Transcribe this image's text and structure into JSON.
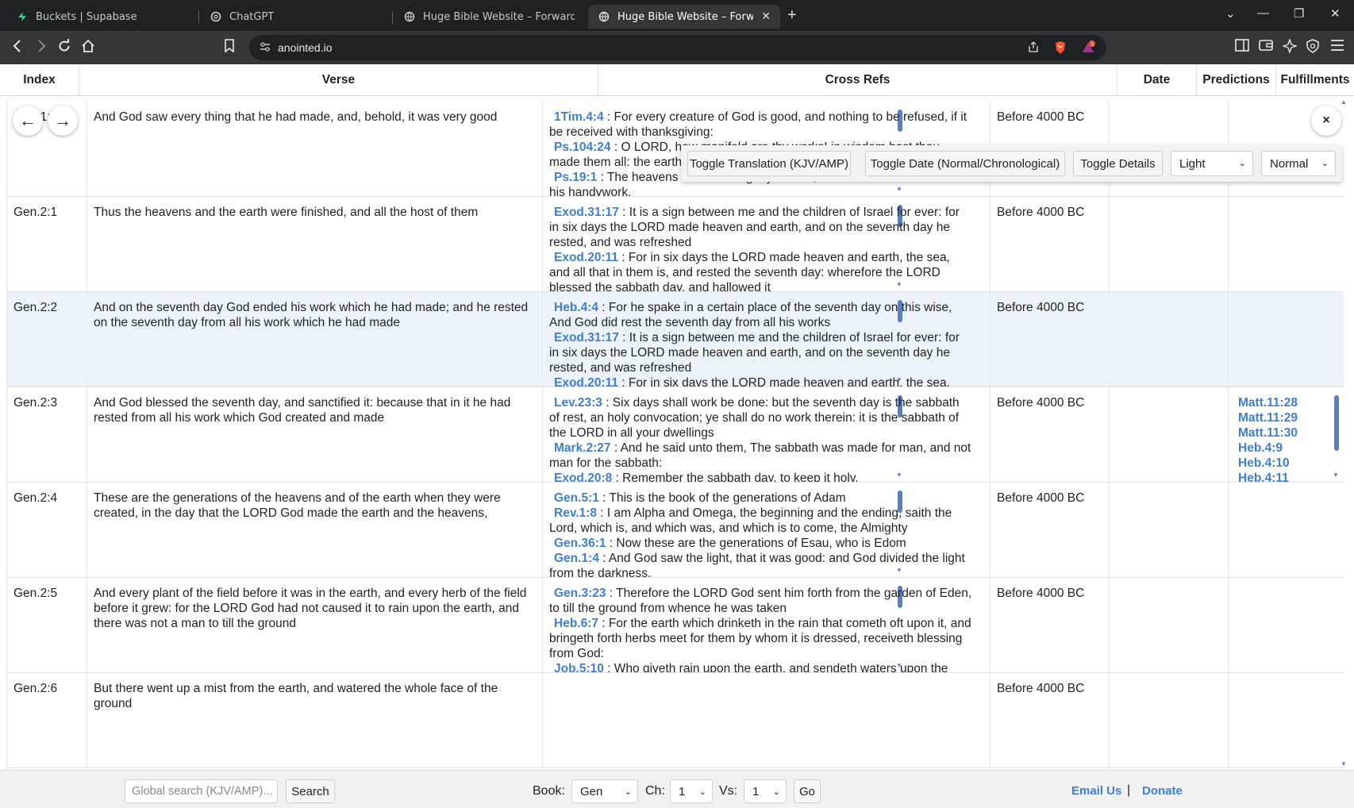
{
  "browser": {
    "tabs": [
      {
        "title": "Buckets | Supabase",
        "icon": "supabase-icon",
        "active": false
      },
      {
        "title": "ChatGPT",
        "icon": "chatgpt-icon",
        "active": false
      },
      {
        "title": "Huge Bible Website – Forward/Back",
        "icon": "globe-icon",
        "active": false
      },
      {
        "title": "Huge Bible Website – Forward/B",
        "icon": "globe-icon",
        "active": true
      }
    ],
    "url": "anointed.io",
    "notification_count": "1"
  },
  "table": {
    "headers": {
      "index": "Index",
      "verse": "Verse",
      "cross_refs": "Cross Refs",
      "date": "Date",
      "predictions": "Predictions",
      "fulfillments": "Fulfillments"
    },
    "rows": [
      {
        "index": "Gen.1:31",
        "verse": "And God saw every thing that he had made, and, behold, it was very good",
        "cross_refs": [
          {
            "ref": "1Tim.4:4",
            "text": " : For every creature of God is good, and nothing to be refused, if it be received with thanksgiving:"
          },
          {
            "ref": "Ps.104:24",
            "text": " : O LORD, how manifold are thy works! in wisdom hast thou made them all: the earth is full of thy riches."
          },
          {
            "ref": "Ps.19:1",
            "text": " : The heavens declare the glory of God; and the firmament sheweth his handywork."
          }
        ],
        "date": "Before 4000 BC",
        "predictions": [],
        "fulfillments": []
      },
      {
        "index": "Gen.2:1",
        "verse": "Thus the heavens and the earth were finished, and all the host of them",
        "cross_refs": [
          {
            "ref": "Exod.31:17",
            "text": " : It is a sign between me and the children of Israel for ever: for in six days the LORD made heaven and earth, and on the seventh day he rested, and was refreshed"
          },
          {
            "ref": "Exod.20:11",
            "text": " : For in six days the LORD made heaven and earth, the sea, and all that in them is, and rested the seventh day: wherefore the LORD blessed the sabbath day, and hallowed it"
          }
        ],
        "date": "Before 4000 BC",
        "predictions": [],
        "fulfillments": []
      },
      {
        "index": "Gen.2:2",
        "verse": "And on the seventh day God ended his work which he had made; and he rested on the seventh day from all his work which he had made",
        "cross_refs": [
          {
            "ref": "Heb.4:4",
            "text": " : For he spake in a certain place of the seventh day on this wise, And God did rest the seventh day from all his works"
          },
          {
            "ref": "Exod.31:17",
            "text": " : It is a sign between me and the children of Israel for ever: for in six days the LORD made heaven and earth, and on the seventh day he rested, and was refreshed"
          },
          {
            "ref": "Exod.20:11",
            "text": " : For in six days the LORD made heaven and earth, the sea, and all that in them is"
          }
        ],
        "date": "Before 4000 BC",
        "predictions": [],
        "fulfillments": []
      },
      {
        "index": "Gen.2:3",
        "verse": "And God blessed the seventh day, and sanctified it: because that in it he had rested from all his work which God created and made",
        "cross_refs": [
          {
            "ref": "Lev.23:3",
            "text": " : Six days shall work be done: but the seventh day is the sabbath of rest, an holy convocation; ye shall do no work therein: it is the sabbath of the LORD in all your dwellings"
          },
          {
            "ref": "Mark.2:27",
            "text": " : And he said unto them, The sabbath was made for man, and not man for the sabbath:"
          },
          {
            "ref": "Exod.20:8",
            "text": " : Remember the sabbath day, to keep it holy."
          }
        ],
        "date": "Before 4000 BC",
        "predictions": [],
        "fulfillments": [
          "Matt.11:28",
          "Matt.11:29",
          "Matt.11:30",
          "Heb.4:9",
          "Heb.4:10",
          "Heb.4:11"
        ]
      },
      {
        "index": "Gen.2:4",
        "verse": "These are the generations of the heavens and of the earth when they were created, in the day that the LORD God made the earth and the heavens,",
        "cross_refs": [
          {
            "ref": "Gen.5:1",
            "text": " : This is the book of the generations of Adam"
          },
          {
            "ref": "Rev.1:8",
            "text": " : I am Alpha and Omega, the beginning and the ending, saith the Lord, which is, and which was, and which is to come, the Almighty"
          },
          {
            "ref": "Gen.36:1",
            "text": " : Now these are the generations of Esau, who is Edom"
          },
          {
            "ref": "Gen.1:4",
            "text": " : And God saw the light, that it was good: and God divided the light from the darkness."
          }
        ],
        "date": "Before 4000 BC",
        "predictions": [],
        "fulfillments": []
      },
      {
        "index": "Gen.2:5",
        "verse": "And every plant of the field before it was in the earth, and every herb of the field before it grew: for the LORD God had not caused it to rain upon the earth, and there was not a man to till the ground",
        "cross_refs": [
          {
            "ref": "Gen.3:23",
            "text": " : Therefore the LORD God sent him forth from the garden of Eden, to till the ground from whence he was taken"
          },
          {
            "ref": "Heb.6:7",
            "text": " : For the earth which drinketh in the rain that cometh oft upon it, and bringeth forth herbs meet for them by whom it is dressed, receiveth blessing from God:"
          },
          {
            "ref": "Job.5:10",
            "text": " : Who giveth rain upon the earth, and sendeth waters upon the fields."
          }
        ],
        "date": "Before 4000 BC",
        "predictions": [],
        "fulfillments": []
      },
      {
        "index": "Gen.2:6",
        "verse": "But there went up a mist from the earth, and watered the whole face of the ground",
        "cross_refs": [],
        "date": "Before 4000 BC",
        "predictions": [],
        "fulfillments": []
      }
    ]
  },
  "overlay": {
    "back_arrow": "←",
    "forward_arrow": "→",
    "close": "×",
    "toggle_translation": "Toggle Translation (KJV/AMP)",
    "toggle_date": "Toggle Date (Normal/Chronological)",
    "toggle_details": "Toggle Details",
    "theme_select": "Light",
    "mode_select": "Normal"
  },
  "footer": {
    "search_placeholder": "Global search (KJV/AMP)...",
    "search_button": "Search",
    "book_label": "Book:",
    "book_value": "Gen",
    "chapter_label": "Ch:",
    "chapter_value": "1",
    "verse_label": "Vs:",
    "verse_value": "1",
    "go_button": "Go",
    "email_link": "Email Us",
    "separator": "|",
    "donate_link": "Donate"
  },
  "colors": {
    "link": "#3f7fd0",
    "highlight_row": "#eef3fb",
    "chrome_dark": "#202124"
  }
}
